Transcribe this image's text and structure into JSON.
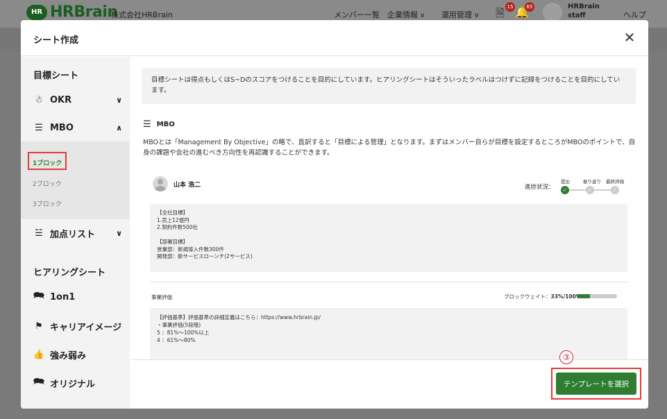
{
  "app": {
    "logo_badge": "HR",
    "logo_text": "HRBrain",
    "company": "株式会社HRBrain",
    "nav": [
      {
        "label": "メンバー一覧"
      },
      {
        "label": "企業情報"
      },
      {
        "label": "運用管理"
      }
    ],
    "badges": {
      "notes": "15",
      "bell": "65"
    },
    "user": {
      "line1": "HRBrain",
      "line2": "staff"
    },
    "help": "ヘルプ"
  },
  "modal": {
    "title": "シート作成",
    "close_icon": "close-icon"
  },
  "sidebar": {
    "goal_section": "目標シート",
    "okr": "OKR",
    "mbo": "MBO",
    "blocks": [
      "1ブロック",
      "2ブロック",
      "3ブロック"
    ],
    "points": "加点リスト",
    "hearing_section": "ヒアリングシート",
    "hearing_items": [
      "1on1",
      "キャリアイメージ",
      "強み弱み",
      "オリジナル"
    ]
  },
  "content": {
    "info": "目標シートは得点もしくはS~Dのスコアをつけることを目的にしています。ヒアリングシートはそういったラベルはつけずに記録をつけることを目的にしています。",
    "section_title": "MBO",
    "description": "MBOとは「Management By Objective」の略で、直訳すると「目標による管理」となります。まずはメンバー自らが目標を設定するところがMBOのポイントで、自身の課題や会社の進むべき方向性を再認識することができます。",
    "card": {
      "user_name": "山本 浩二",
      "progress_label": "進捗状況：",
      "steps": [
        "提出",
        "振り返り",
        "最終評価"
      ],
      "goals": [
        "【全社目標】",
        "1.売上12億円",
        "2.契約件数500社",
        "",
        "【部署目標】",
        "営業部：新規導入件数300件",
        "開発部：新サービスローンチ(2サービス)"
      ],
      "eval_title": "事業評価",
      "weight_label": "ブロックウェイト：",
      "weight_value": "33%/100%",
      "weight_fraction": 0.33,
      "eval_lines": [
        "【評価基準】評価基準の詳細定義はこちら：https://www.hrbrain.jp/",
        "・事業評価(5段階)",
        "5 ：81%〜100%以上",
        "4 ：61%〜80%"
      ]
    }
  },
  "footer": {
    "annotation": "③",
    "select_button": "テンプレートを選択"
  },
  "colors": {
    "accent": "#2e7d32",
    "highlight": "#e53935"
  }
}
